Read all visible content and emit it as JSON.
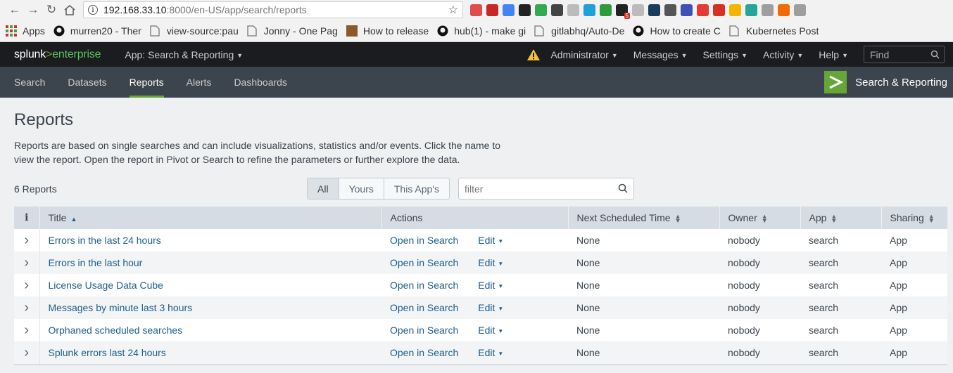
{
  "browser": {
    "url_host": "192.168.33.10",
    "url_path": ":8000/en-US/app/search/reports",
    "bookmarks": [
      {
        "label": "Apps",
        "icon": "apps-grid-icon",
        "color": "#d93025"
      },
      {
        "label": "murren20 - Ther",
        "icon": "github-icon",
        "color": "#111111"
      },
      {
        "label": "view-source:pau",
        "icon": "page-icon",
        "color": "#777777"
      },
      {
        "label": "Jonny - One Pag",
        "icon": "page-icon",
        "color": "#777777"
      },
      {
        "label": "How to release",
        "icon": "image-icon",
        "color": "#8a5a2b"
      },
      {
        "label": "hub(1) - make gi",
        "icon": "github-icon",
        "color": "#111111"
      },
      {
        "label": "gitlabhq/Auto-De",
        "icon": "page-icon",
        "color": "#777777"
      },
      {
        "label": "How to create C",
        "icon": "github-icon",
        "color": "#111111"
      },
      {
        "label": "Kubernetes Post",
        "icon": "page-icon",
        "color": "#777777"
      }
    ],
    "extensions": [
      "#e04b4b",
      "#c62828",
      "#4285f4",
      "#222222",
      "#34a853",
      "#444444",
      "#bbbbbb",
      "#1ea0d8",
      "#2e9b3a",
      "#222222",
      "#bbbbbb",
      "#1a3b5d",
      "#555555",
      "#3f51b5",
      "#e53935",
      "#d93025",
      "#f4b400",
      "#26a69a",
      "#9e9e9e",
      "#ef6c00",
      "#9e9e9e"
    ],
    "ext_badge": "5"
  },
  "splunk": {
    "logo_splunk": "splunk",
    "logo_gt": ">",
    "logo_enterprise": "enterprise",
    "app_menu": "App: Search & Reporting",
    "menu": [
      "Administrator",
      "Messages",
      "Settings",
      "Activity",
      "Help"
    ],
    "find_placeholder": "Find",
    "tabs": [
      "Search",
      "Datasets",
      "Reports",
      "Alerts",
      "Dashboards"
    ],
    "active_tab": "Reports",
    "app_title": "Search & Reporting",
    "accent": "#65a637"
  },
  "page": {
    "title": "Reports",
    "description": "Reports are based on single searches and can include visualizations, statistics and/or events. Click the name to view the report. Open the report in Pivot or Search to refine the parameters or further explore the data.",
    "count": "6 Reports",
    "filter_buttons": [
      "All",
      "Yours",
      "This App's"
    ],
    "filter_placeholder": "filter"
  },
  "table": {
    "headers": [
      "i",
      "Title",
      "Actions",
      "Next Scheduled Time",
      "Owner",
      "App",
      "Sharing"
    ],
    "rows": [
      {
        "title": "Errors in the last 24 hours",
        "open": "Open in Search",
        "edit": "Edit",
        "next": "None",
        "owner": "nobody",
        "app": "search",
        "sharing": "App"
      },
      {
        "title": "Errors in the last hour",
        "open": "Open in Search",
        "edit": "Edit",
        "next": "None",
        "owner": "nobody",
        "app": "search",
        "sharing": "App"
      },
      {
        "title": "License Usage Data Cube",
        "open": "Open in Search",
        "edit": "Edit",
        "next": "None",
        "owner": "nobody",
        "app": "search",
        "sharing": "App"
      },
      {
        "title": "Messages by minute last 3 hours",
        "open": "Open in Search",
        "edit": "Edit",
        "next": "None",
        "owner": "nobody",
        "app": "search",
        "sharing": "App"
      },
      {
        "title": "Orphaned scheduled searches",
        "open": "Open in Search",
        "edit": "Edit",
        "next": "None",
        "owner": "nobody",
        "app": "search",
        "sharing": "App"
      },
      {
        "title": "Splunk errors last 24 hours",
        "open": "Open in Search",
        "edit": "Edit",
        "next": "None",
        "owner": "nobody",
        "app": "search",
        "sharing": "App"
      }
    ]
  }
}
